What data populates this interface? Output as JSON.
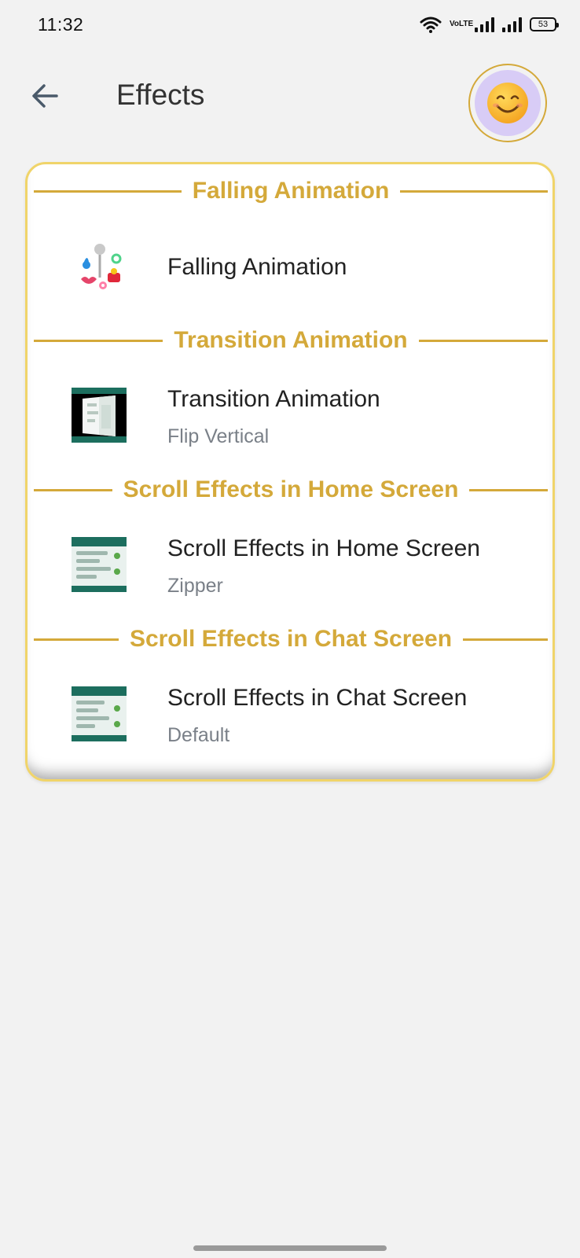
{
  "status_bar": {
    "time": "11:32",
    "volte_label": "VoLTE",
    "battery_level": "53"
  },
  "app_bar": {
    "title": "Effects",
    "back_icon": "arrow-left-icon",
    "avatar_icon": "smiling-face-icon"
  },
  "sections": [
    {
      "header": "Falling Animation",
      "item_title": "Falling Animation",
      "item_subtitle": "",
      "thumb_icon": "falling-items-icon"
    },
    {
      "header": "Transition Animation",
      "item_title": "Transition Animation",
      "item_subtitle": "Flip Vertical",
      "thumb_icon": "flip-screen-thumbnail"
    },
    {
      "header": "Scroll Effects in Home Screen",
      "item_title": "Scroll Effects in Home Screen",
      "item_subtitle": "Zipper",
      "thumb_icon": "home-screen-thumbnail"
    },
    {
      "header": "Scroll Effects in Chat Screen",
      "item_title": "Scroll Effects in Chat Screen",
      "item_subtitle": "Default",
      "thumb_icon": "chat-screen-thumbnail"
    }
  ],
  "colors": {
    "accent": "#d4a93a",
    "card_border": "#f0d46a",
    "avatar_bg": "#d8ccf6",
    "app_green": "#1c6e5e",
    "background": "#f2f2f2"
  }
}
